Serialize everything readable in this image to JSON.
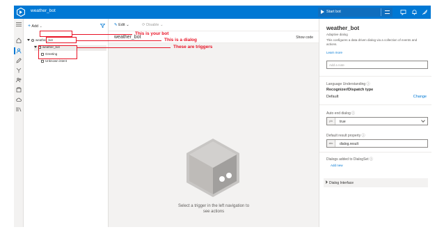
{
  "app": {
    "title": "weather_bot",
    "start_button_label": "Start bot"
  },
  "sidebar": {
    "add_label": "Add"
  },
  "tree": {
    "bot": "weather_bot",
    "dialog": "weather_bot",
    "triggers": [
      "Greeting",
      "Unknown intent"
    ]
  },
  "toolbar": {
    "edit_label": "Edit",
    "disable_label": "Disable"
  },
  "canvas": {
    "dialog_name": "weather_bot",
    "show_code_label": "Show code",
    "empty_message": "Select a trigger in the left navigation to see actions"
  },
  "properties": {
    "title": "weather_bot",
    "type": "Adaptive dialog",
    "description": "This configures a data driven dialog via a collection of events and actions.",
    "learn_more": "Learn more",
    "note_placeholder": "Add a note",
    "lu_label": "Language Understanding",
    "recognizer_label": "Recognizer/Dispatch type",
    "recognizer_value": "Default",
    "change_label": "Change",
    "auto_end_label": "Auto end dialog",
    "auto_end_tag": "y/n",
    "auto_end_value": "true",
    "default_result_label": "Default result property",
    "default_result_tag": "abc",
    "default_result_value": "dialog.result",
    "dialogs_added_label": "Dialogs added to DialogSet",
    "add_new_label": "Add new",
    "dialog_interface_label": "Dialog Interface"
  },
  "annotations": {
    "bot": "This is your bot",
    "dialog": "This is a dialog",
    "triggers": "These are triggers"
  },
  "colors": {
    "brand": "#0078d4",
    "annotation": "#e81123"
  }
}
